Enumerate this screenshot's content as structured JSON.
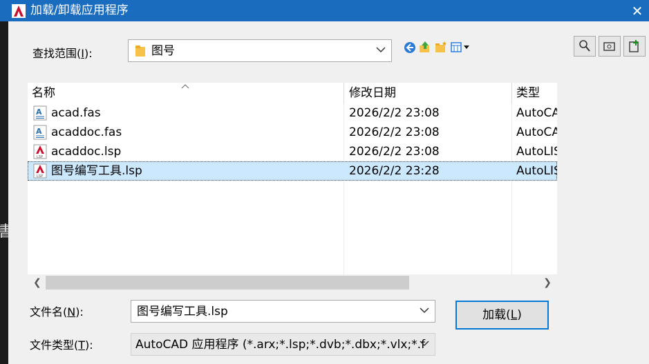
{
  "window": {
    "title": "加载/卸载应用程序",
    "close_glyph": "✕"
  },
  "lookin": {
    "label_prefix": "查找范围(",
    "label_key": "I",
    "label_suffix": "):",
    "value": "图号"
  },
  "columns": {
    "name": "名称",
    "modified": "修改日期",
    "type": "类型"
  },
  "files": [
    {
      "name": "acad.fas",
      "modified": "2026/2/2 23:08",
      "type": "AutoCAD",
      "icon": "fas-file-icon",
      "selected": false
    },
    {
      "name": "acaddoc.fas",
      "modified": "2026/2/2 23:08",
      "type": "AutoCAD",
      "icon": "fas-file-icon",
      "selected": false
    },
    {
      "name": "acaddoc.lsp",
      "modified": "2026/2/2 23:08",
      "type": "AutoLISP",
      "icon": "lsp-file-icon",
      "selected": false
    },
    {
      "name": "图号编写工具.lsp",
      "modified": "2026/2/2 23:28",
      "type": "AutoLISP",
      "icon": "lsp-file-icon",
      "selected": true
    }
  ],
  "filename": {
    "label_prefix": "文件名(",
    "label_key": "N",
    "label_suffix": "):",
    "value": "图号编写工具.lsp"
  },
  "filetype": {
    "label_prefix": "文件类型(",
    "label_key": "T",
    "label_suffix": "):",
    "value": "AutoCAD 应用程序 (*.arx;*.lsp;*.dvb;*.dbx;*.vlx;*.f"
  },
  "load_button": {
    "label_prefix": "加载(",
    "label_key": "L",
    "label_suffix": ")"
  },
  "background_text": "書",
  "colors": {
    "titlebar": "#1a6cbf",
    "selection": "#cce8ff",
    "focus_border": "#0078d7"
  }
}
